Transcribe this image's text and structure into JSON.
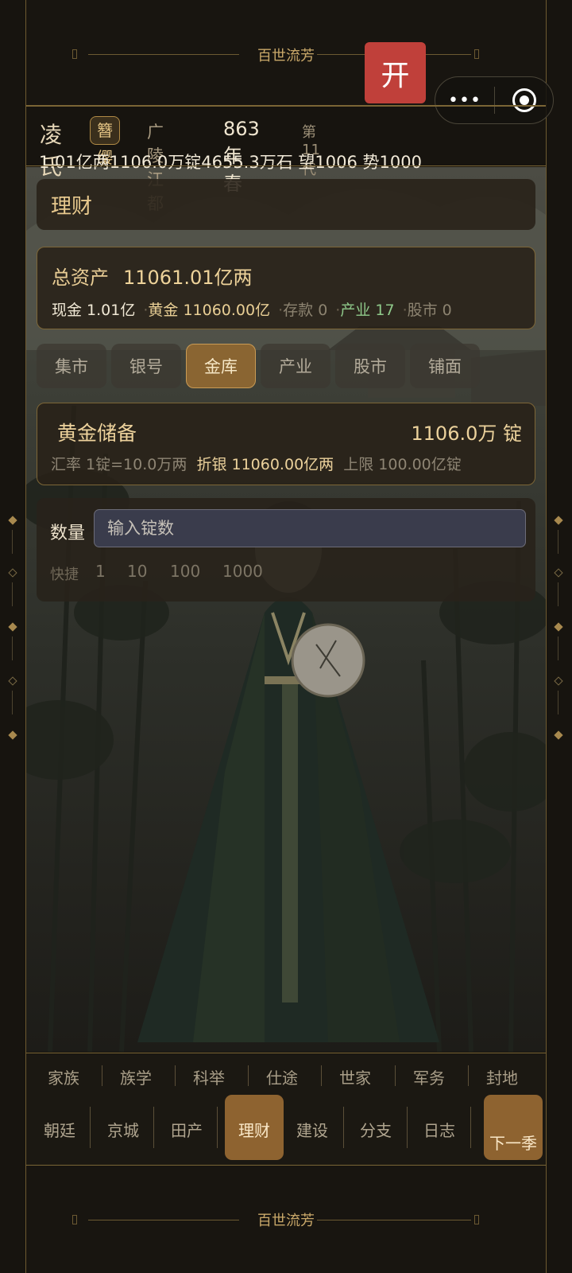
{
  "banner": {
    "title_top": "百世流芳",
    "title_bottom": "百世流芳",
    "open_label": "开"
  },
  "capsule": {
    "more": "•••",
    "record": "record-icon"
  },
  "header": {
    "name": "凌氏",
    "badge": "簪缨",
    "place": "广陵江都",
    "year": "863年春",
    "generation": "第11代",
    "stats": "1.01亿两1106.0万锭4655.3万石  望1006 势1000"
  },
  "page_title": "理财",
  "assets": {
    "label": "总资产",
    "value": "11061.01亿两",
    "cash": "现金 1.01亿",
    "gold": "黄金 11060.00亿",
    "deposit": "存款 0",
    "industry": "产业 17",
    "stock": "股市 0"
  },
  "tabs": [
    "集市",
    "银号",
    "金库",
    "产业",
    "股市",
    "铺面"
  ],
  "active_tab": "金库",
  "reserve": {
    "title": "黄金储备",
    "amount": "1106.0万 锭",
    "rate": "汇率 1锭=10.0万两",
    "converted": "折银 11060.00亿两",
    "limit": "上限 100.00亿锭"
  },
  "quantity": {
    "label": "数量",
    "placeholder": "输入锭数",
    "quick_label": "快捷",
    "options": [
      "1",
      "10",
      "100",
      "1000"
    ]
  },
  "nav": {
    "row1": [
      "家族",
      "族学",
      "科举",
      "仕途",
      "世家",
      "军务",
      "封地"
    ],
    "row2": [
      "朝廷",
      "京城",
      "田产",
      "理财",
      "建设",
      "分支",
      "日志"
    ],
    "active": "理财",
    "next": "下一季"
  },
  "colors": {
    "accent": "#8e6330",
    "gold_text": "#e9cf95",
    "industry_green": "#8fc98a",
    "open_button": "#c0403a"
  }
}
